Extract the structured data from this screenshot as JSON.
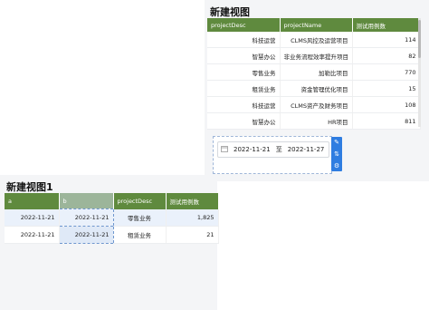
{
  "top_view": {
    "title": "新建视图",
    "columns": [
      "projectDesc",
      "projectName",
      "测试用例数"
    ],
    "rows": [
      {
        "desc": "科技运营",
        "name": "CLMS风控及运营项目",
        "count": "114"
      },
      {
        "desc": "智慧办公",
        "name": "非业务流程效率提升项目",
        "count": "82"
      },
      {
        "desc": "零售业务",
        "name": "加勒比项目",
        "count": "770"
      },
      {
        "desc": "租赁业务",
        "name": "资金管理优化项目",
        "count": "15"
      },
      {
        "desc": "科技运营",
        "name": "CLMS资产及财务项目",
        "count": "108"
      },
      {
        "desc": "智慧办公",
        "name": "HR项目",
        "count": "811"
      }
    ]
  },
  "filter": {
    "start_date": "2022-11-21",
    "separator": "至",
    "end_date": "2022-11-27",
    "calendar_icon": "calendar-icon",
    "tool_icons": [
      "edit-icon",
      "adjust-icon",
      "settings-icon"
    ],
    "accent_color": "#2f7de1"
  },
  "bottom_view": {
    "title": "新建视图1",
    "columns": [
      "a",
      "b",
      "projectDesc",
      "测试用例数"
    ],
    "rows": [
      {
        "a": "2022-11-21",
        "b": "2022-11-21",
        "desc": "零售业务",
        "count": "1,825"
      },
      {
        "a": "2022-11-21",
        "b": "2022-11-21",
        "desc": "租赁业务",
        "count": "21"
      }
    ]
  },
  "colors": {
    "header_green": "#5f8a3e",
    "header_selected": "#9cb59a",
    "panel_gray": "#f4f5f7"
  }
}
